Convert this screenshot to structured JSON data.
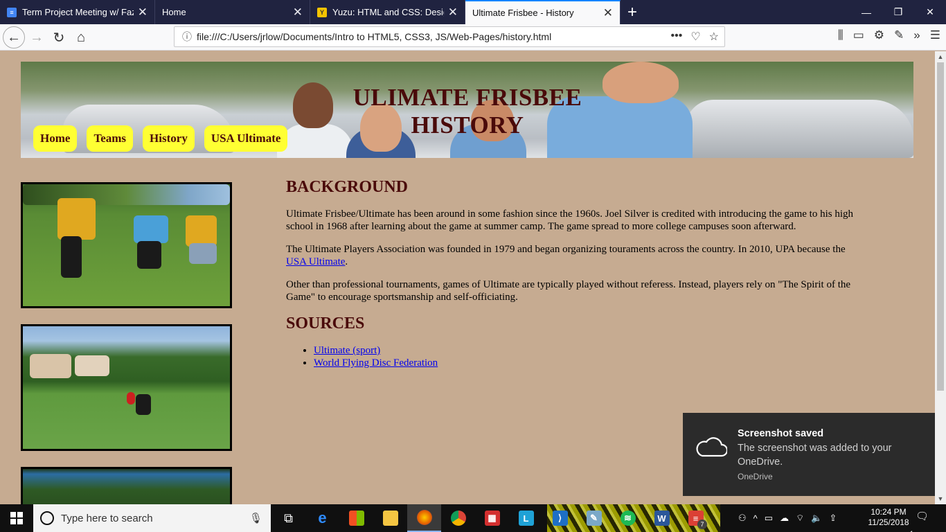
{
  "browser": {
    "tabs": [
      {
        "title": "Term Project Meeting w/ Fazil T",
        "icon": "google-docs-icon",
        "color": "#4285f4",
        "active": false
      },
      {
        "title": "Home",
        "icon": "page-icon",
        "color": "#ffffff",
        "active": false
      },
      {
        "title": "Yuzu: HTML and CSS: Design a",
        "icon": "yuzu-icon",
        "color": "#f5c400",
        "active": false
      },
      {
        "title": "Ultimate Frisbee - History",
        "icon": "page-icon",
        "color": "#ffffff",
        "active": true
      }
    ],
    "url": "file:///C:/Users/jrlow/Documents/Intro to HTML5, CSS3, JS/Web-Pages/history.html"
  },
  "page": {
    "banner_title": "ULIMATE FRISBEE HISTORY",
    "nav": [
      {
        "label": "Home"
      },
      {
        "label": "Teams"
      },
      {
        "label": "History"
      },
      {
        "label": "USA Ultimate"
      }
    ],
    "background_heading": "BACKGROUND",
    "para1": "Ultimate Frisbee/Ultimate has been around in some fashion since the 1960s. Joel Silver is credited with introducing the game to his high school in 1968 after learning about the game at summer camp. The game spread to more college campuses soon afterward.",
    "para2_before": "The Ultimate Players Association was founded in 1979 and began organizing touraments across the country. In 2010, UPA because the ",
    "para2_link": "USA Ultimate",
    "para2_after": ".",
    "para3": "Other than professional tournaments, games of Ultimate are typically played without referess. Instead, players rely on \"The Spirit of the Game\" to encourage sportsmanship and self-officiating.",
    "sources_heading": "SOURCES",
    "sources": [
      {
        "label": "Ultimate (sport)"
      },
      {
        "label": "World Flying Disc Federation"
      }
    ]
  },
  "toast": {
    "title": "Screenshot saved",
    "message": "The screenshot was added to your OneDrive.",
    "source": "OneDrive"
  },
  "taskbar": {
    "search_placeholder": "Type here to search",
    "time": "10:24 PM",
    "date": "11/25/2018",
    "notification_count": "1",
    "todoist_badge": "7"
  },
  "colors": {
    "page_bg": "#c6ab91",
    "heading": "#4a0a0a",
    "nav_button": "#ffff33",
    "link": "#0000ee"
  }
}
